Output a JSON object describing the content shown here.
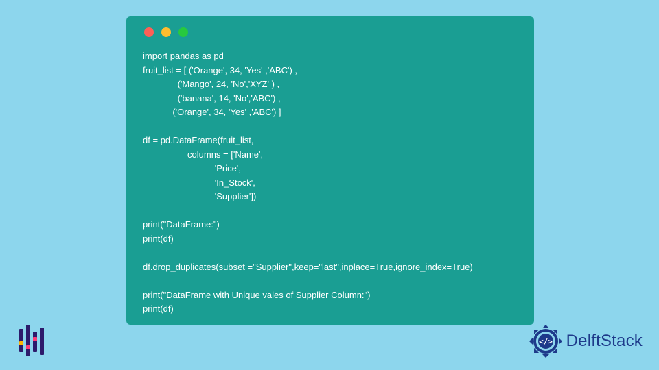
{
  "code": {
    "lines": [
      "import pandas as pd",
      "fruit_list = [ ('Orange', 34, 'Yes' ,'ABC') ,",
      "              ('Mango', 24, 'No','XYZ' ) ,",
      "              ('banana', 14, 'No','ABC') ,",
      "            ('Orange', 34, 'Yes' ,'ABC') ]",
      "",
      "df = pd.DataFrame(fruit_list,",
      "                  columns = ['Name',",
      "                             'Price',",
      "                             'In_Stock',",
      "                             'Supplier'])",
      "",
      "print(\"DataFrame:\")",
      "print(df)",
      "",
      "df.drop_duplicates(subset =\"Supplier\",keep=\"last\",inplace=True,ignore_index=True)",
      "",
      "print(\"DataFrame with Unique vales of Supplier Column:\")",
      "print(df)"
    ]
  },
  "brand": {
    "name": "DelftStack"
  },
  "colors": {
    "window_bg": "#1a9e93",
    "page_bg": "#8dd6ed",
    "brand_blue": "#1e3a8a"
  }
}
